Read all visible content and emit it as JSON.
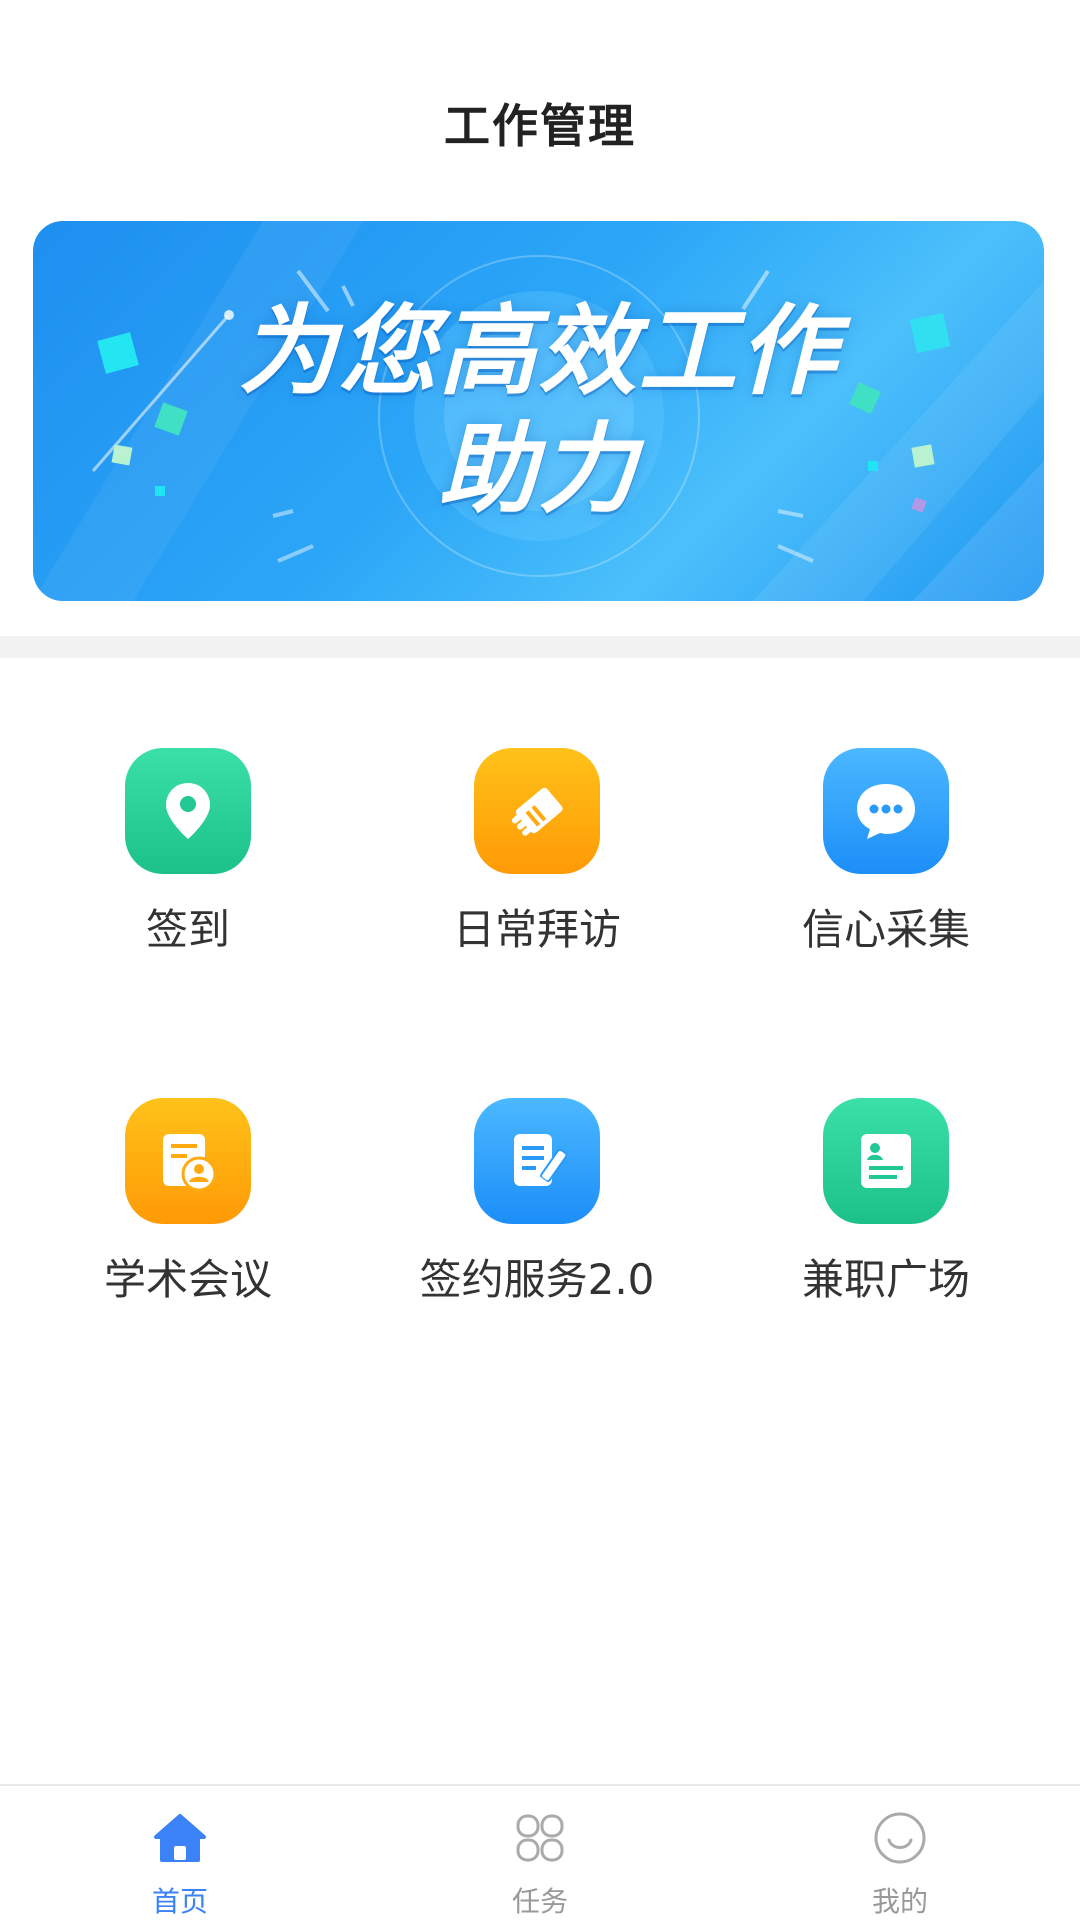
{
  "header": {
    "title": "工作管理"
  },
  "banner": {
    "line1": "为您高效工作",
    "line2": "助力"
  },
  "menu": [
    {
      "label": "签到",
      "icon": "location-pin-icon",
      "color": "green"
    },
    {
      "label": "日常拜访",
      "icon": "handshake-icon",
      "color": "orange"
    },
    {
      "label": "信心采集",
      "icon": "chat-bubble-icon",
      "color": "blue"
    },
    {
      "label": "学术会议",
      "icon": "conference-badge-icon",
      "color": "orange"
    },
    {
      "label": "签约服务2.0",
      "icon": "document-edit-icon",
      "color": "blue"
    },
    {
      "label": "兼职广场",
      "icon": "profile-card-icon",
      "color": "green"
    }
  ],
  "tabbar": {
    "home": "首页",
    "tasks": "任务",
    "mine": "我的"
  },
  "colors": {
    "accent": "#3b82f6",
    "tab_inactive": "#999999",
    "green": "#1cc189",
    "orange": "#ff9a05",
    "blue": "#1c8ef8"
  }
}
